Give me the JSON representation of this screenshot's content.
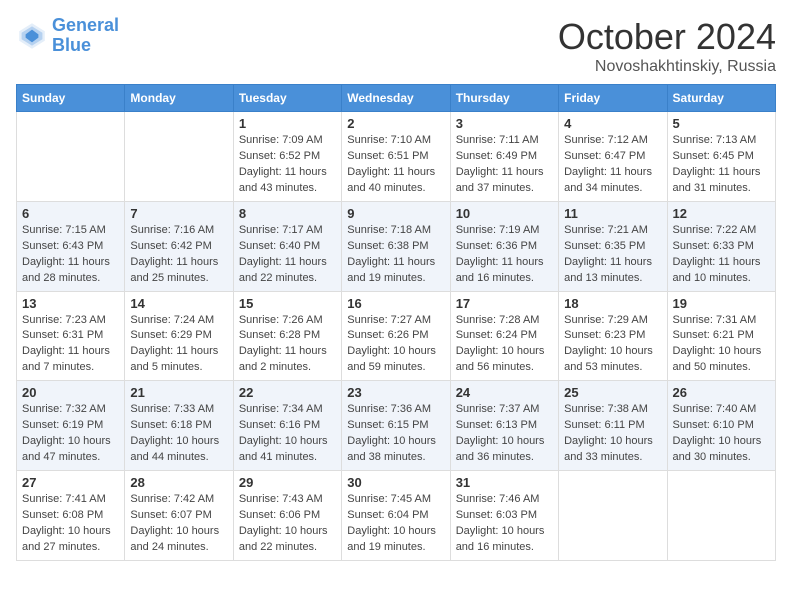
{
  "header": {
    "logo_line1": "General",
    "logo_line2": "Blue",
    "month": "October 2024",
    "location": "Novoshakhtinskiy, Russia"
  },
  "weekdays": [
    "Sunday",
    "Monday",
    "Tuesday",
    "Wednesday",
    "Thursday",
    "Friday",
    "Saturday"
  ],
  "weeks": [
    [
      {
        "day": "",
        "info": ""
      },
      {
        "day": "",
        "info": ""
      },
      {
        "day": "1",
        "info": "Sunrise: 7:09 AM\nSunset: 6:52 PM\nDaylight: 11 hours and 43 minutes."
      },
      {
        "day": "2",
        "info": "Sunrise: 7:10 AM\nSunset: 6:51 PM\nDaylight: 11 hours and 40 minutes."
      },
      {
        "day": "3",
        "info": "Sunrise: 7:11 AM\nSunset: 6:49 PM\nDaylight: 11 hours and 37 minutes."
      },
      {
        "day": "4",
        "info": "Sunrise: 7:12 AM\nSunset: 6:47 PM\nDaylight: 11 hours and 34 minutes."
      },
      {
        "day": "5",
        "info": "Sunrise: 7:13 AM\nSunset: 6:45 PM\nDaylight: 11 hours and 31 minutes."
      }
    ],
    [
      {
        "day": "6",
        "info": "Sunrise: 7:15 AM\nSunset: 6:43 PM\nDaylight: 11 hours and 28 minutes."
      },
      {
        "day": "7",
        "info": "Sunrise: 7:16 AM\nSunset: 6:42 PM\nDaylight: 11 hours and 25 minutes."
      },
      {
        "day": "8",
        "info": "Sunrise: 7:17 AM\nSunset: 6:40 PM\nDaylight: 11 hours and 22 minutes."
      },
      {
        "day": "9",
        "info": "Sunrise: 7:18 AM\nSunset: 6:38 PM\nDaylight: 11 hours and 19 minutes."
      },
      {
        "day": "10",
        "info": "Sunrise: 7:19 AM\nSunset: 6:36 PM\nDaylight: 11 hours and 16 minutes."
      },
      {
        "day": "11",
        "info": "Sunrise: 7:21 AM\nSunset: 6:35 PM\nDaylight: 11 hours and 13 minutes."
      },
      {
        "day": "12",
        "info": "Sunrise: 7:22 AM\nSunset: 6:33 PM\nDaylight: 11 hours and 10 minutes."
      }
    ],
    [
      {
        "day": "13",
        "info": "Sunrise: 7:23 AM\nSunset: 6:31 PM\nDaylight: 11 hours and 7 minutes."
      },
      {
        "day": "14",
        "info": "Sunrise: 7:24 AM\nSunset: 6:29 PM\nDaylight: 11 hours and 5 minutes."
      },
      {
        "day": "15",
        "info": "Sunrise: 7:26 AM\nSunset: 6:28 PM\nDaylight: 11 hours and 2 minutes."
      },
      {
        "day": "16",
        "info": "Sunrise: 7:27 AM\nSunset: 6:26 PM\nDaylight: 10 hours and 59 minutes."
      },
      {
        "day": "17",
        "info": "Sunrise: 7:28 AM\nSunset: 6:24 PM\nDaylight: 10 hours and 56 minutes."
      },
      {
        "day": "18",
        "info": "Sunrise: 7:29 AM\nSunset: 6:23 PM\nDaylight: 10 hours and 53 minutes."
      },
      {
        "day": "19",
        "info": "Sunrise: 7:31 AM\nSunset: 6:21 PM\nDaylight: 10 hours and 50 minutes."
      }
    ],
    [
      {
        "day": "20",
        "info": "Sunrise: 7:32 AM\nSunset: 6:19 PM\nDaylight: 10 hours and 47 minutes."
      },
      {
        "day": "21",
        "info": "Sunrise: 7:33 AM\nSunset: 6:18 PM\nDaylight: 10 hours and 44 minutes."
      },
      {
        "day": "22",
        "info": "Sunrise: 7:34 AM\nSunset: 6:16 PM\nDaylight: 10 hours and 41 minutes."
      },
      {
        "day": "23",
        "info": "Sunrise: 7:36 AM\nSunset: 6:15 PM\nDaylight: 10 hours and 38 minutes."
      },
      {
        "day": "24",
        "info": "Sunrise: 7:37 AM\nSunset: 6:13 PM\nDaylight: 10 hours and 36 minutes."
      },
      {
        "day": "25",
        "info": "Sunrise: 7:38 AM\nSunset: 6:11 PM\nDaylight: 10 hours and 33 minutes."
      },
      {
        "day": "26",
        "info": "Sunrise: 7:40 AM\nSunset: 6:10 PM\nDaylight: 10 hours and 30 minutes."
      }
    ],
    [
      {
        "day": "27",
        "info": "Sunrise: 7:41 AM\nSunset: 6:08 PM\nDaylight: 10 hours and 27 minutes."
      },
      {
        "day": "28",
        "info": "Sunrise: 7:42 AM\nSunset: 6:07 PM\nDaylight: 10 hours and 24 minutes."
      },
      {
        "day": "29",
        "info": "Sunrise: 7:43 AM\nSunset: 6:06 PM\nDaylight: 10 hours and 22 minutes."
      },
      {
        "day": "30",
        "info": "Sunrise: 7:45 AM\nSunset: 6:04 PM\nDaylight: 10 hours and 19 minutes."
      },
      {
        "day": "31",
        "info": "Sunrise: 7:46 AM\nSunset: 6:03 PM\nDaylight: 10 hours and 16 minutes."
      },
      {
        "day": "",
        "info": ""
      },
      {
        "day": "",
        "info": ""
      }
    ]
  ]
}
